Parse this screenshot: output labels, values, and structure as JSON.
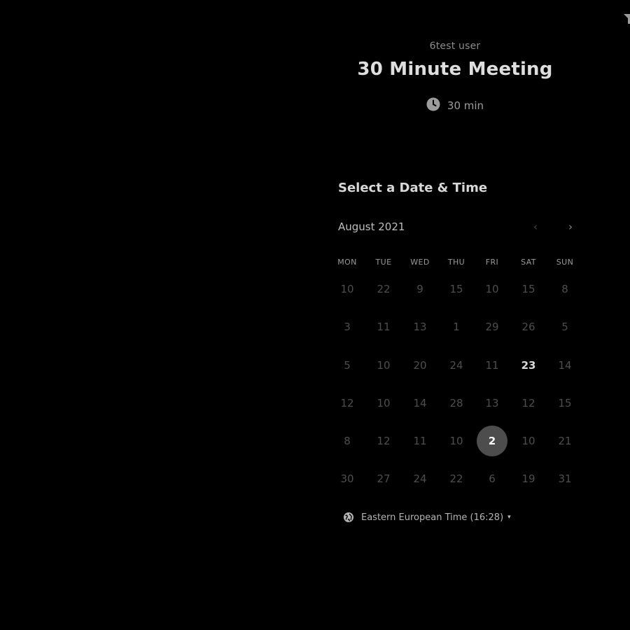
{
  "event": {
    "organizer": "6test user",
    "title": "30 Minute Meeting",
    "duration": "30 min",
    "duration_icon": "clock-icon"
  },
  "calendar": {
    "heading": "Select a Date & Time",
    "month": "August 2021",
    "prev_icon": "‹",
    "next_icon": "›",
    "weekdays": [
      "MON",
      "TUE",
      "WED",
      "THU",
      "FRI",
      "SAT",
      "SUN"
    ],
    "weeks": [
      [
        "10",
        "22",
        "9",
        "15",
        "10",
        "15",
        "8"
      ],
      [
        "3",
        "11",
        "13",
        "1",
        "29",
        "26",
        "5"
      ],
      [
        "5",
        "10",
        "20",
        "24",
        "11",
        "23",
        "14"
      ],
      [
        "12",
        "10",
        "14",
        "28",
        "13",
        "12",
        "15"
      ],
      [
        "8",
        "12",
        "11",
        "10",
        "2",
        "10",
        "21"
      ],
      [
        "30",
        "27",
        "24",
        "22",
        "6",
        "19",
        "31"
      ]
    ],
    "available_day": "23",
    "selected_day": "2"
  },
  "timezone": {
    "label": "Eastern European Time (16:28)",
    "caret": "▾",
    "icon": "globe-icon"
  },
  "colors": {
    "background": "#000000",
    "selected_day_bg": "#4d4d4d",
    "muted_text": "#4e4e4e"
  }
}
